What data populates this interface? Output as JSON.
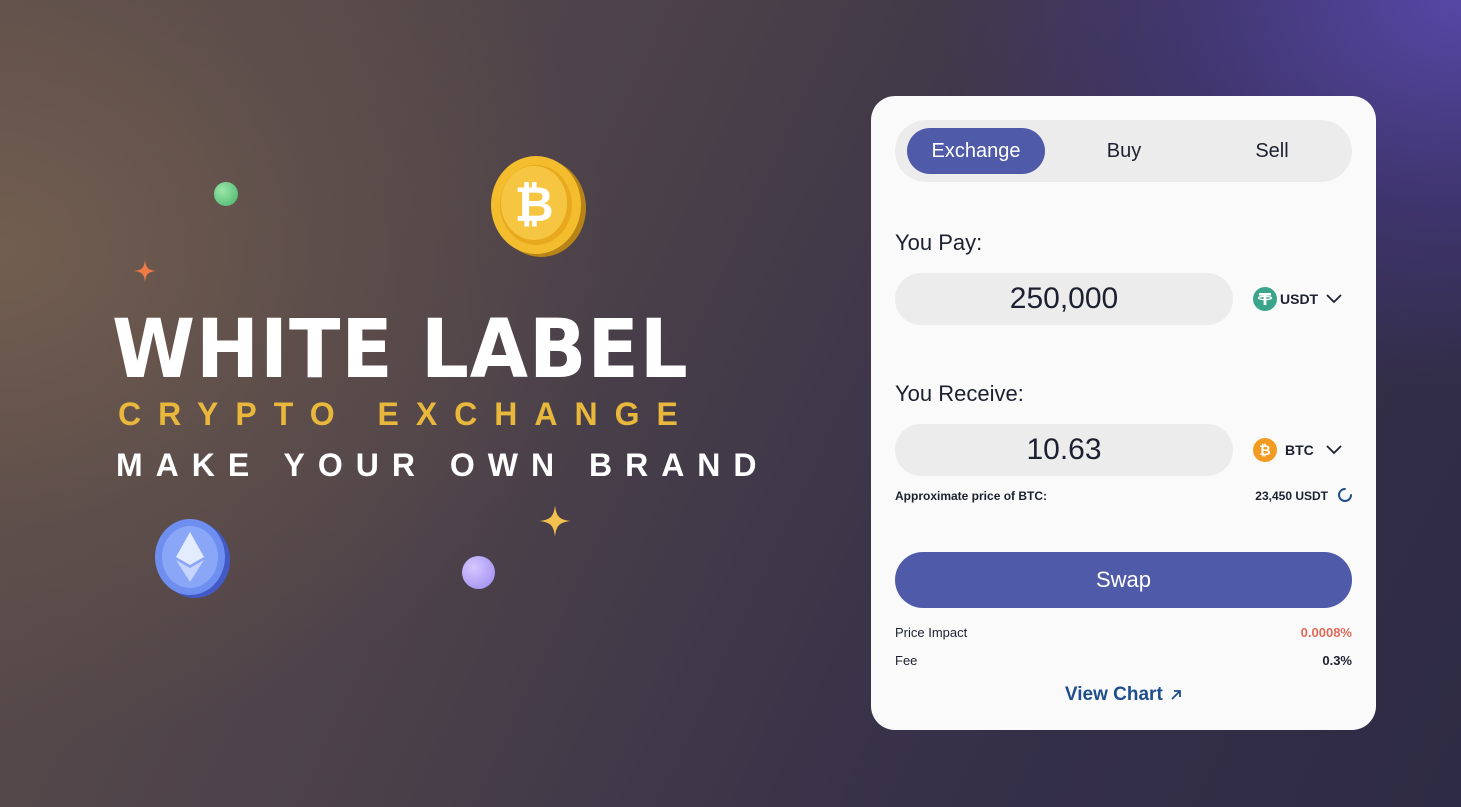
{
  "hero": {
    "title": "WHITE LABEL",
    "subtitle": "CRYPTO EXCHANGE",
    "tagline": "MAKE YOUR OWN BRAND"
  },
  "tabs": [
    {
      "label": "Exchange",
      "active": true
    },
    {
      "label": "Buy",
      "active": false
    },
    {
      "label": "Sell",
      "active": false
    }
  ],
  "pay": {
    "label": "You Pay:",
    "amount": "250,000",
    "token": "USDT",
    "token_icon": "tether-icon"
  },
  "receive": {
    "label": "You Receive:",
    "amount": "10.63",
    "token": "BTC",
    "token_icon": "bitcoin-icon"
  },
  "approx": {
    "label": "Approximate price of BTC:",
    "value": "23,450 USDT"
  },
  "swap_label": "Swap",
  "price_impact": {
    "label": "Price Impact",
    "value": "0.0008%"
  },
  "fee": {
    "label": "Fee",
    "value": "0.3%"
  },
  "view_chart": "View Chart",
  "colors": {
    "accent": "#4f5aa8",
    "gold": "#e8b73c",
    "impact": "#e06a5a",
    "link": "#1f4e8c"
  }
}
